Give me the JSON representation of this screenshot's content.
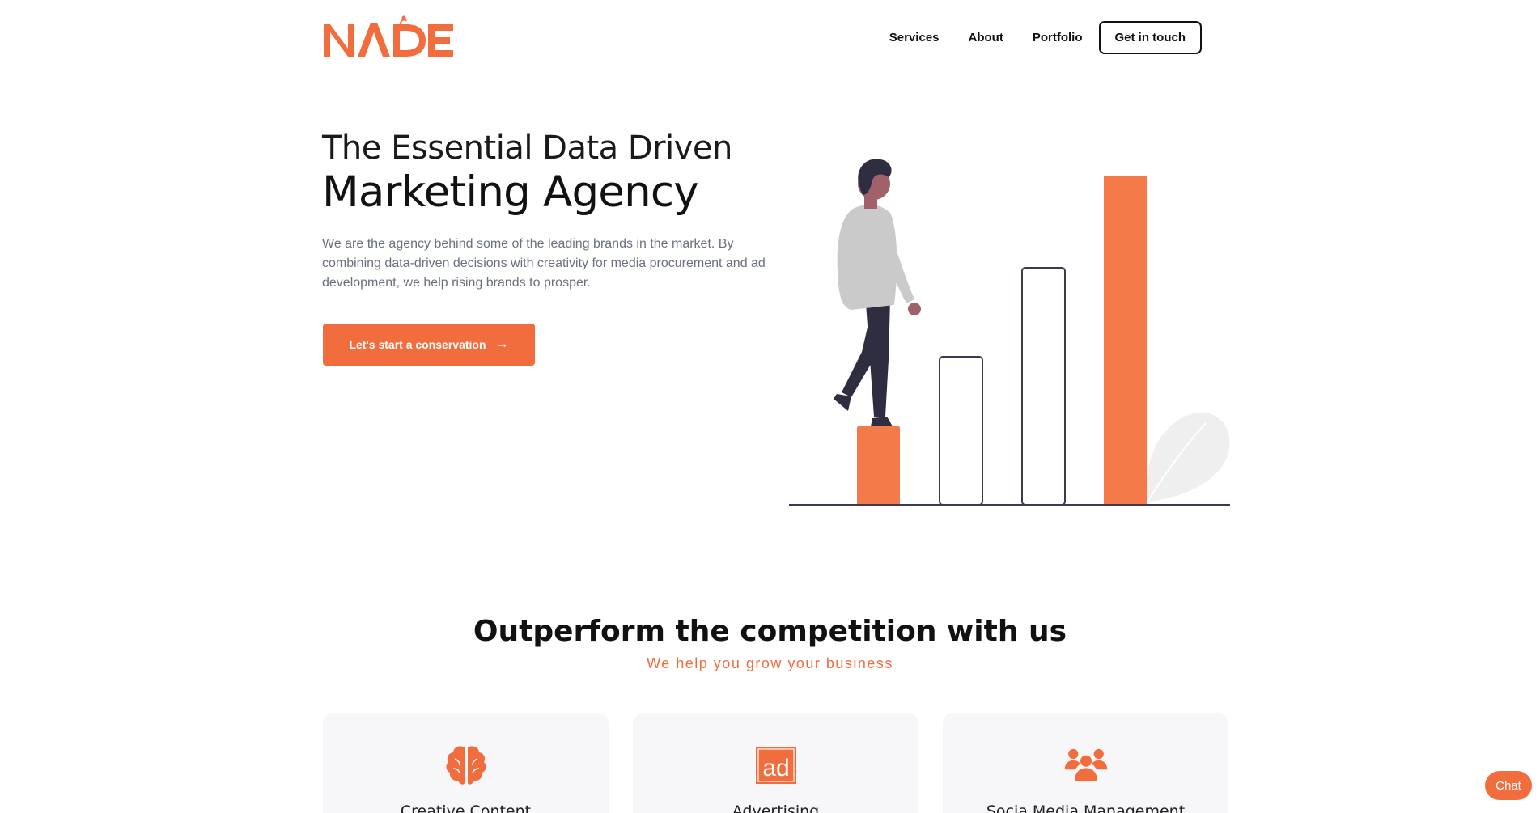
{
  "header": {
    "logo_text": "NADE",
    "nav": [
      "Services",
      "About",
      "Portfolio"
    ],
    "cta": "Get in touch"
  },
  "hero": {
    "title_line1": "The Essential Data Driven",
    "title_line2": "Marketing Agency",
    "description": "We are the agency behind some of the leading brands in the market. By combining data-driven decisions with creativity for media procurement and ad development, we help rising brands to prosper.",
    "button_label": "Let's start a conservation",
    "button_arrow": "→"
  },
  "section": {
    "title": "Outperform the competition with us",
    "subtitle": "We help you grow your business"
  },
  "services": [
    {
      "title": "Creative Content",
      "icon": "brain-icon"
    },
    {
      "title": "Advertising",
      "icon": "ad-icon"
    },
    {
      "title": "Socia Media Management",
      "icon": "users-icon"
    }
  ],
  "chat": {
    "label": "Chat"
  },
  "colors": {
    "accent": "#f26d3d",
    "text": "#111111",
    "muted": "#6b7080",
    "card_bg": "#f7f7fa"
  }
}
